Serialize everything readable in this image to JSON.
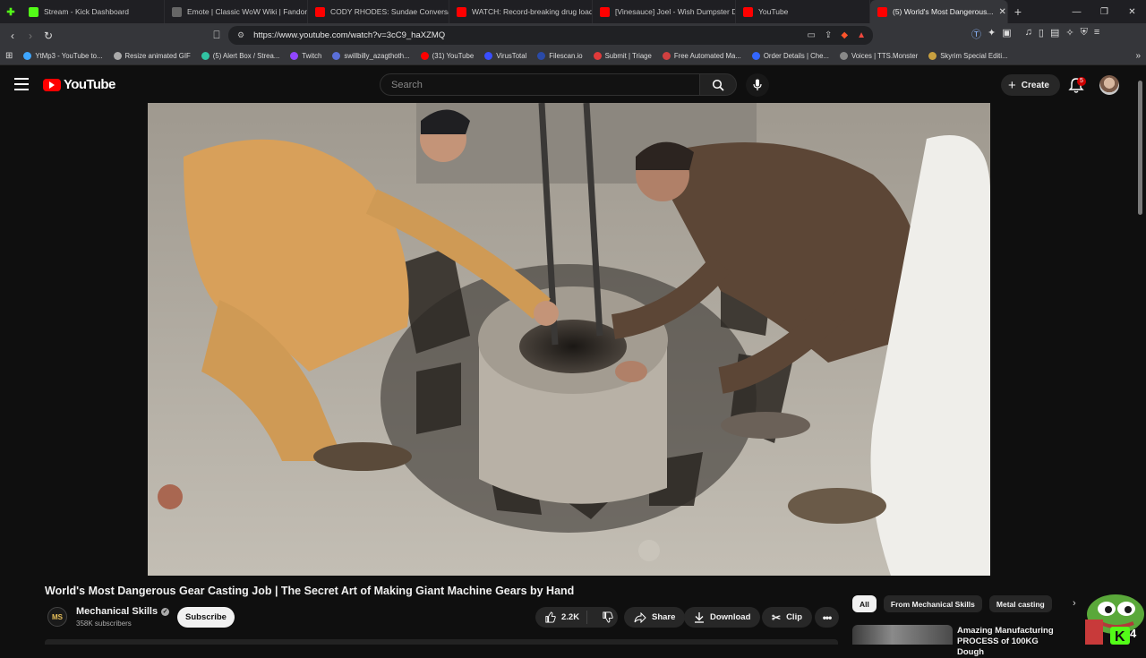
{
  "browser": {
    "tabs": [
      {
        "label": "Stream - Kick Dashboard",
        "color": "#53fc18",
        "icon": "kick-icon"
      },
      {
        "label": "Emote | Classic WoW Wiki | Fandom",
        "color": "#666666",
        "icon": "fandom-icon"
      },
      {
        "label": "CODY RHODES: Sundae Conversati...",
        "color": "#ff0000",
        "icon": "youtube-icon"
      },
      {
        "label": "WATCH: Record-breaking drug load...",
        "color": "#ff0000",
        "icon": "youtube-icon"
      },
      {
        "label": "[Vinesauce] Joel - Wish Dumpster D...",
        "color": "#ff0000",
        "icon": "youtube-icon"
      },
      {
        "label": "YouTube",
        "color": "#ff0000",
        "icon": "youtube-icon"
      },
      {
        "label": "(5) World's Most Dangerous...",
        "color": "#ff0000",
        "icon": "youtube-icon",
        "active": true
      }
    ],
    "url": "https://www.youtube.com/watch?v=3cC9_haXZMQ",
    "bookmarks": [
      {
        "label": "YtMp3 - YouTube to...",
        "color": "#3ea6ff"
      },
      {
        "label": "Resize animated GIF",
        "color": "#aaaaaa"
      },
      {
        "label": "(5) Alert Box / Strea...",
        "color": "#31c3a2"
      },
      {
        "label": "Twitch",
        "color": "#9146ff"
      },
      {
        "label": "swillbilly_azagthoth...",
        "color": "#5a6fd8"
      },
      {
        "label": "(31) YouTube",
        "color": "#ff0000"
      },
      {
        "label": "VirusTotal",
        "color": "#394eff"
      },
      {
        "label": "Filescan.io",
        "color": "#2a4aa8"
      },
      {
        "label": "Submit | Triage",
        "color": "#e03a3a"
      },
      {
        "label": "Free Automated Ma...",
        "color": "#d04040"
      },
      {
        "label": "Order Details | Che...",
        "color": "#3366ff"
      },
      {
        "label": "Voices | TTS.Monster",
        "color": "#888888"
      },
      {
        "label": "Skyrim Special Editi...",
        "color": "#c8a040"
      }
    ]
  },
  "youtube": {
    "logo_text": "YouTube",
    "search_placeholder": "Search",
    "create_label": "Create",
    "notification_count": "5"
  },
  "video": {
    "title": "World's Most Dangerous Gear Casting Job | The Secret Art of Making Giant Machine Gears by Hand",
    "channel": "Mechanical Skills",
    "subscribers": "358K subscribers",
    "subscribe_label": "Subscribe",
    "likes": "2.2K",
    "share_label": "Share",
    "download_label": "Download",
    "clip_label": "Clip"
  },
  "sidebar": {
    "chips": [
      "All",
      "From Mechanical Skills",
      "Metal casting"
    ],
    "rec_title": "Amazing Manufacturing PROCESS of 100KG Dough"
  },
  "overlay": {
    "kick_count": "4"
  }
}
